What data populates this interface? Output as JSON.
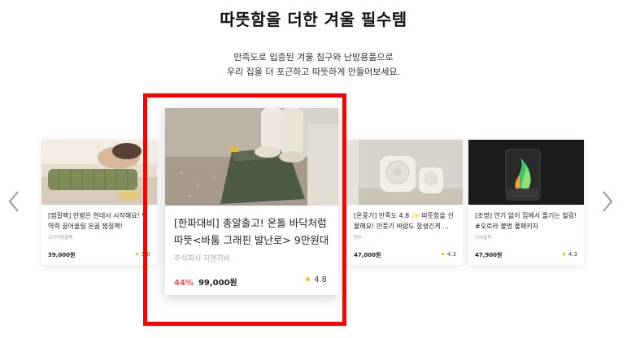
{
  "section": {
    "title": "따뜻함을 더한 겨울 필수템",
    "subtitle_line1": "만족도로 입증된 겨울 침구와 난방용품으로",
    "subtitle_line2": "우리 집을 더 포근하고 따뜻하게 만들어보세요."
  },
  "cards": [
    {
      "name": "[찜질팩] 만병은 한데서 시작해요! 면역력 끌어올릴 온골 찜질팩!",
      "seller": "코끼리찜질팩",
      "price": "39,000원",
      "rating": "5.0"
    },
    {
      "name": "[한파대비] 총알출고! 온돌 바닥처럼 따뜻<바툼 그래핀 발난로> 9만원대",
      "seller": "주식회사 지엔지비",
      "discount": "44%",
      "price": "99,000원",
      "rating": "4.8"
    },
    {
      "name": "[온풍기] 만족도 4.8 ✨ 따뜻함을 선물해요! 만풍기 바람도 잘생긴게 ...",
      "seller": "원두",
      "price": "47,000원",
      "rating": "4.3"
    },
    {
      "name": "[조명] 연기 없이 집에서 즐기는 힐링! #오로라 불멍 풀패키지",
      "seller": "스마홈픽",
      "price": "47,900원",
      "rating": "4.3"
    }
  ],
  "icons": {
    "prev": "chevron-left-icon",
    "next": "chevron-right-icon",
    "star": "star-icon"
  },
  "colors": {
    "discount": "#ff4d4d",
    "star": "#f5b800",
    "highlight": "#ff0000"
  }
}
